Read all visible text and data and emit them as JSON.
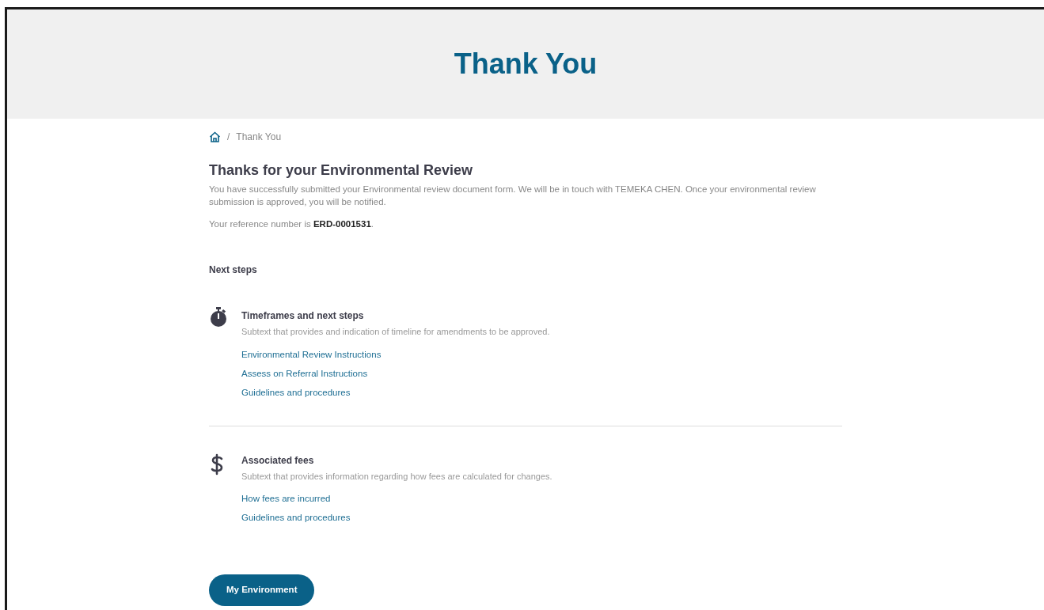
{
  "header": {
    "title": "Thank You"
  },
  "breadcrumb": {
    "current": "Thank You",
    "separator": "/"
  },
  "heading": "Thanks for your Environmental Review",
  "intro": "You have successfully submitted your Environmental review document form. We will be in touch with TEMEKA CHEN. Once your environmental review submission is approved, you will be notified.",
  "reference": "Your reference number is **ERD-0001531**.",
  "next_steps_label": "Next steps",
  "sections": [
    {
      "kind": "stopwatch",
      "title": "Timeframes and next steps",
      "subtext": "Subtext that provides and indication of timeline for amendments to be approved.",
      "links": [
        "Environmental Review Instructions",
        "Assess on Referral Instructions",
        "Guidelines and procedures"
      ]
    },
    {
      "kind": "dollar",
      "title": "Associated fees",
      "subtext": "Subtext that provides information regarding how fees are calculated for changes.",
      "links": [
        "How fees are incurred",
        "Guidelines and procedures"
      ]
    }
  ],
  "button": "My Environment"
}
